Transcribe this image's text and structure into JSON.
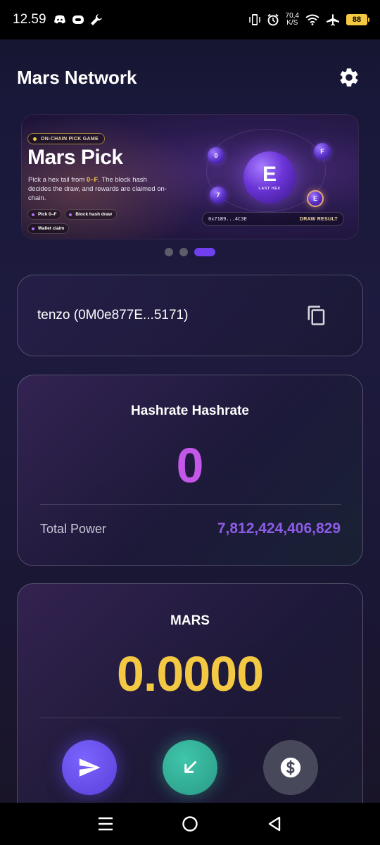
{
  "status_bar": {
    "time": "12.59",
    "speed_value": "70,4",
    "speed_unit": "K/S",
    "battery": "88"
  },
  "header": {
    "title": "Mars Network"
  },
  "banner": {
    "badge": "ON-CHAIN PICK GAME",
    "title": "Mars Pick",
    "desc_pre": "Pick a hex tail from ",
    "desc_highlight": "0–F",
    "desc_post": ". The block hash decides the draw, and rewards are claimed on-chain.",
    "chips": [
      "Pick 0–F",
      "Block hash draw",
      "Wallet claim"
    ],
    "orb_letter": "E",
    "orb_caption": "LAST HEX",
    "small_orbs": [
      "0",
      "F",
      "7",
      "E"
    ],
    "hash": "0x71B9...4C3E",
    "draw_label": "DRAW RESULT"
  },
  "carousel": {
    "count": 3,
    "active_index": 2
  },
  "wallet": {
    "label": "tenzo (0M0e877E...5171)"
  },
  "hashrate": {
    "title": "Hashrate Hashrate",
    "value": "0",
    "total_power_label": "Total Power",
    "total_power_value": "7,812,424,406,829"
  },
  "mars": {
    "title": "MARS",
    "balance": "0.0000"
  },
  "colors": {
    "accent_purple": "#6f3ff0",
    "hash_value": "#c257e8",
    "total_power": "#8d5ce6",
    "mars_gold": "#f3c843",
    "send": "#5a3fd9",
    "receive": "#2a9a86",
    "swap": "#474859"
  },
  "icons": {
    "settings": "gear-icon",
    "copy": "copy-icon",
    "send": "send-icon",
    "receive": "arrow-down-left-icon",
    "swap": "dollar-circle-icon"
  }
}
